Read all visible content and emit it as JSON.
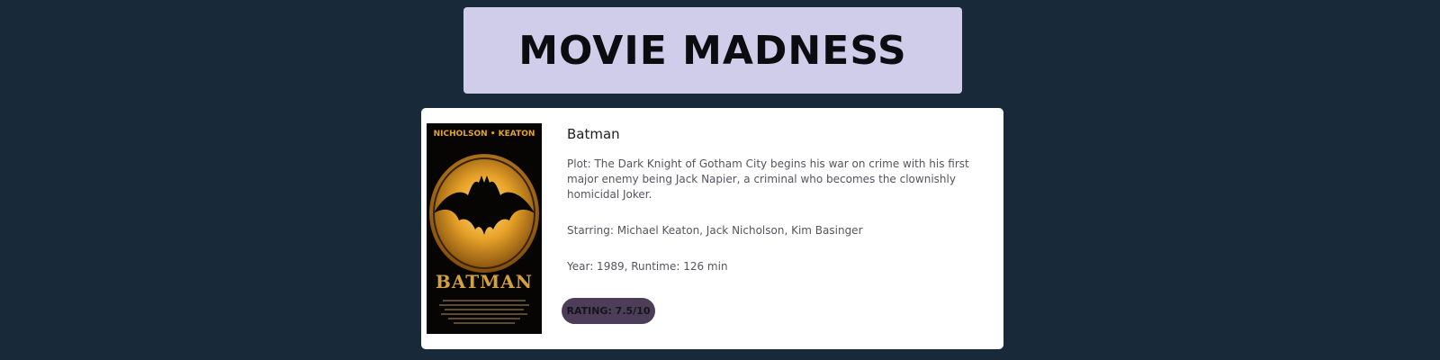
{
  "header": {
    "title": "MOVIE MADNESS"
  },
  "movie": {
    "title": "Batman",
    "plot": "Plot: The Dark Knight of Gotham City begins his war on crime with his first major enemy being Jack Napier, a criminal who becomes the clownishly homicidal Joker.",
    "starring": "Starring: Michael Keaton, Jack Nicholson, Kim Basinger",
    "year_runtime": "Year: 1989, Runtime: 126 min",
    "rating": "RATING: 7.5/10",
    "poster": {
      "top_text": "NICHOLSON • KEATON",
      "title_text": "BATMAN",
      "icon": "bat-symbol-icon"
    }
  },
  "colors": {
    "background": "#18293a",
    "header_bg": "#cfcdea",
    "card_bg": "#ffffff",
    "badge_bg": "#4c3d58",
    "poster_gold": "#e7a228"
  }
}
